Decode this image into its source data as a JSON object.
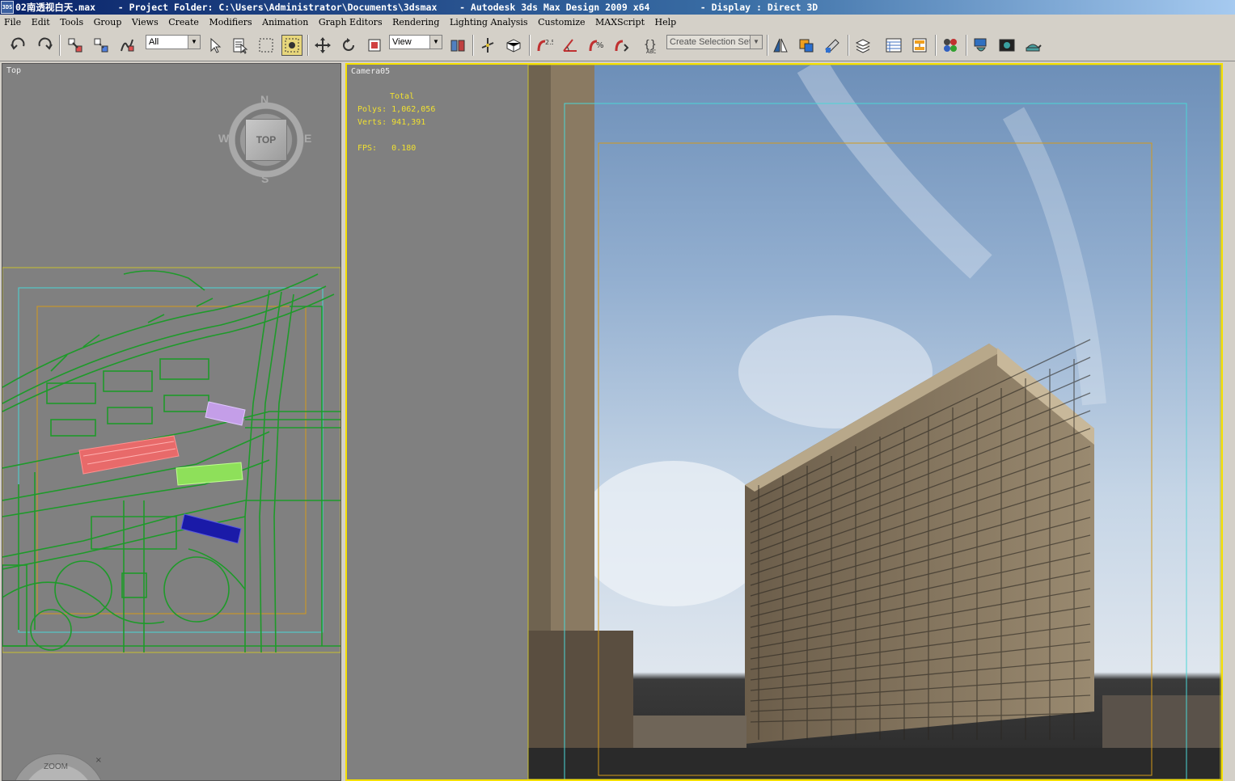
{
  "titlebar": {
    "text": "02南透视白天.max    - Project Folder: C:\\Users\\Administrator\\Documents\\3dsmax    - Autodesk 3ds Max Design 2009 x64         - Display : Direct 3D",
    "icon_text": "3DS"
  },
  "menu": [
    "File",
    "Edit",
    "Tools",
    "Group",
    "Views",
    "Create",
    "Modifiers",
    "Animation",
    "Graph Editors",
    "Rendering",
    "Lighting Analysis",
    "Customize",
    "MAXScript",
    "Help"
  ],
  "toolbar": {
    "filter_value": "All",
    "refcoord_value": "View",
    "selection_set_placeholder": "Create Selection Set",
    "snap_value": "2.5"
  },
  "viewport_top": {
    "label": "Top",
    "viewcube_face": "TOP",
    "compass": {
      "n": "N",
      "s": "S",
      "e": "E",
      "w": "W"
    },
    "zoom_gizmo_label": "ZOOM",
    "zoom_close": "×"
  },
  "viewport_camera": {
    "label": "Camera05",
    "stats_header": "Total",
    "polys_label": "Polys:",
    "polys_value": "1,062,056",
    "verts_label": "Verts:",
    "verts_value": "941,391",
    "fps_label": "FPS:",
    "fps_value": "0.180"
  },
  "colors": {
    "active_border": "#f5e000",
    "plan_lines": "#1e9a2a",
    "bldg_red": "#e86a6a",
    "bldg_purple": "#c49ee8",
    "bldg_lightgreen": "#8ee05a",
    "bldg_blue": "#1a1aa8",
    "safe_frame_cyan": "#4ad6d6",
    "safe_frame_orange": "#d49a1a"
  }
}
